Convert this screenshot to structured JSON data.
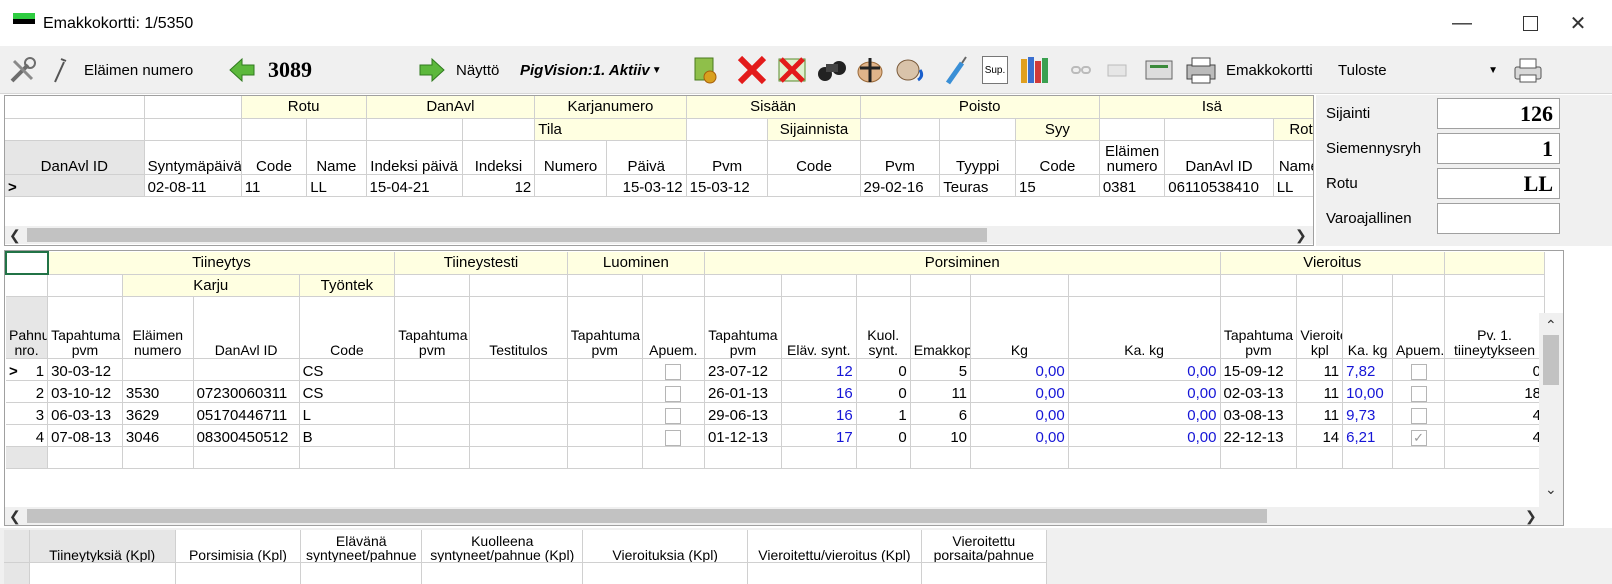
{
  "window": {
    "title": "Emakkokortti: 1/5350"
  },
  "toolbar": {
    "animal_label": "Eläimen numero",
    "animal_number": "3089",
    "view_label": "Näyttö",
    "view_value": "PigVision:1. Aktiiv",
    "sup_label": "Sup.",
    "report_label": "Emakkokortti",
    "print_label": "Tuloste"
  },
  "top_grid": {
    "groups": [
      "Rotu",
      "DanAvl",
      "Karjanumero",
      "Sisään",
      "Poisto",
      "Isä"
    ],
    "subgroups": {
      "tila": "Tila",
      "sijainnista": "Sijainnista",
      "syy": "Syy",
      "rotu": "Rotu"
    },
    "columns": [
      "DanAvl ID",
      "Syntymäpäivä",
      "Code",
      "Name",
      "Indeksi päivä",
      "Indeksi",
      "Numero",
      "Päivä",
      "Pvm",
      "Code",
      "Pvm",
      "Tyyppi",
      "Code",
      "Eläimen numero",
      "DanAvl ID",
      "Name"
    ],
    "row": [
      "",
      "02-08-11",
      "11",
      "LL",
      "15-04-21",
      "12",
      "",
      "15-03-12",
      "15-03-12",
      "",
      "29-02-16",
      "Teuras",
      "15",
      "0381",
      "06110538410",
      "LL"
    ]
  },
  "side_panel": {
    "sijainti_label": "Sijainti",
    "sijainti_value": "126",
    "siemennysryh_label": "Siemennysryh",
    "siemennysryh_value": "1",
    "rotu_label": "Rotu",
    "rotu_value": "LL",
    "varoajallinen_label": "Varoajallinen",
    "varoajallinen_value": ""
  },
  "main_grid": {
    "groups": [
      "Tiineytys",
      "Tiineystesti",
      "Luominen",
      "Porsiminen",
      "Vieroitus"
    ],
    "subgroups": {
      "karju": "Karju",
      "tyontek": "Työntek"
    },
    "columns": [
      "Pahnue nro.",
      "Tapahtuma pvm",
      "Eläimen numero",
      "DanAvl ID",
      "Code",
      "Tapahtuma pvm",
      "Testitulos",
      "Tapahtuma pvm",
      "Apuem.",
      "Tapahtuma pvm",
      "Eläv. synt.",
      "Kuol. synt.",
      "Emakkoporsaat",
      "Kg",
      "Ka. kg",
      "Tapahtuma pvm",
      "Vieroitettu kpl",
      "Ka. kg",
      "Apuem.",
      "Pv. 1. tiineytykseen"
    ],
    "rows": [
      {
        "nro": "1",
        "t_pvm": "30-03-12",
        "el_nro": "",
        "danavl": "",
        "code": "CS",
        "tt_pvm": "",
        "testitulos": "",
        "l_pvm": "",
        "p_pvm": "23-07-12",
        "elav": "12",
        "kuol": "0",
        "emakko": "5",
        "kg": "0,00",
        "kakg": "0,00",
        "v_pvm": "15-09-12",
        "v_kpl": "11",
        "v_kakg": "7,82",
        "v_apuem": false,
        "pv1": "0"
      },
      {
        "nro": "2",
        "t_pvm": "03-10-12",
        "el_nro": "3530",
        "danavl": "07230060311",
        "code": "CS",
        "tt_pvm": "",
        "testitulos": "",
        "l_pvm": "",
        "p_pvm": "26-01-13",
        "elav": "16",
        "kuol": "0",
        "emakko": "11",
        "kg": "0,00",
        "kakg": "0,00",
        "v_pvm": "02-03-13",
        "v_kpl": "11",
        "v_kakg": "10,00",
        "v_apuem": false,
        "pv1": "18"
      },
      {
        "nro": "3",
        "t_pvm": "06-03-13",
        "el_nro": "3629",
        "danavl": "05170446711",
        "code": "L",
        "tt_pvm": "",
        "testitulos": "",
        "l_pvm": "",
        "p_pvm": "29-06-13",
        "elav": "16",
        "kuol": "1",
        "emakko": "6",
        "kg": "0,00",
        "kakg": "0,00",
        "v_pvm": "03-08-13",
        "v_kpl": "11",
        "v_kakg": "9,73",
        "v_apuem": false,
        "pv1": "4"
      },
      {
        "nro": "4",
        "t_pvm": "07-08-13",
        "el_nro": "3046",
        "danavl": "08300450512",
        "code": "B",
        "tt_pvm": "",
        "testitulos": "",
        "l_pvm": "",
        "p_pvm": "01-12-13",
        "elav": "17",
        "kuol": "0",
        "emakko": "10",
        "kg": "0,00",
        "kakg": "0,00",
        "v_pvm": "22-12-13",
        "v_kpl": "14",
        "v_kakg": "6,21",
        "v_apuem": true,
        "pv1": "4"
      }
    ]
  },
  "summary_grid": {
    "columns": [
      "Tiineytyksiä (Kpl)",
      "Porsimisia (Kpl)",
      "Elävänä syntyneet/pahnue",
      "Kuolleena syntyneet/pahnue (Kpl)",
      "Vieroituksia (Kpl)",
      "Vieroitettu/vieroitus (Kpl)",
      "Vieroitettu porsaita/pahnue"
    ]
  }
}
